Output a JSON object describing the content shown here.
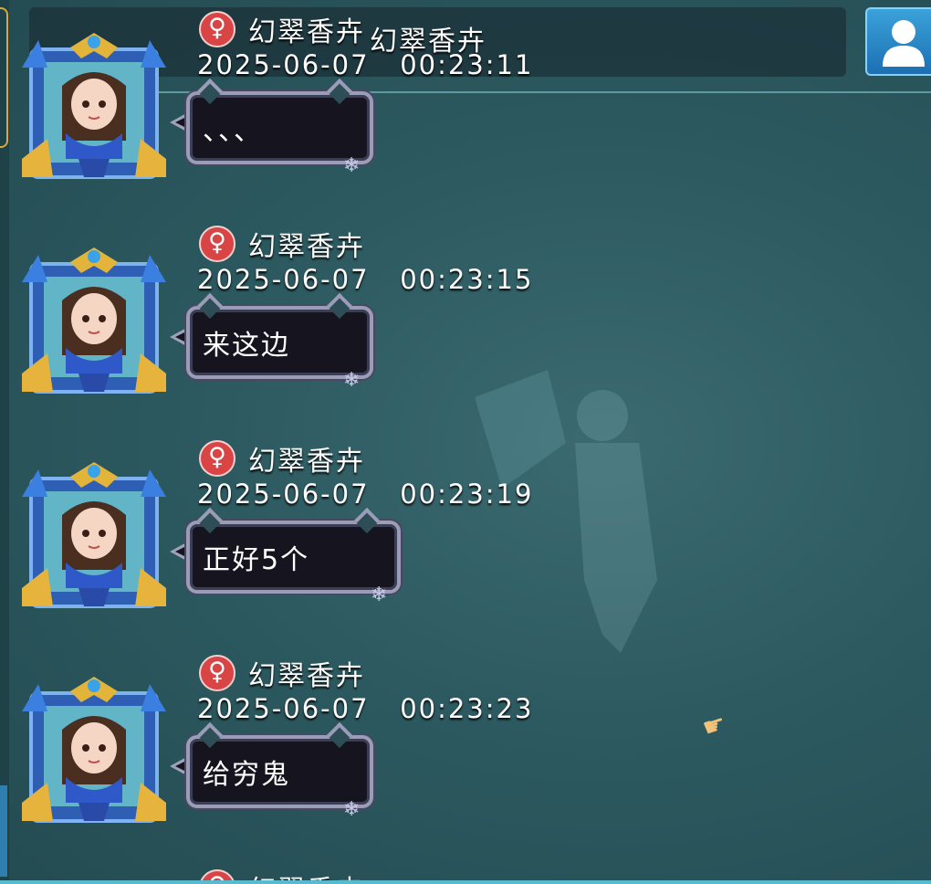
{
  "header": {
    "title": "幻翠香卉"
  },
  "messages": [
    {
      "gender_symbol": "♀",
      "sender": "幻翠香卉",
      "timestamp": "2025-06-07   00:23:11",
      "text": "、、、"
    },
    {
      "gender_symbol": "♀",
      "sender": "幻翠香卉",
      "timestamp": "2025-06-07   00:23:15",
      "text": "来这边"
    },
    {
      "gender_symbol": "♀",
      "sender": "幻翠香卉",
      "timestamp": "2025-06-07   00:23:19",
      "text": "正好5个"
    },
    {
      "gender_symbol": "♀",
      "sender": "幻翠香卉",
      "timestamp": "2025-06-07   00:23:23",
      "text": "给穷鬼"
    }
  ],
  "partial_message": {
    "gender_symbol": "♀",
    "sender": "幻翠香卉"
  },
  "icons": {
    "profile_button": "user-silhouette-icon",
    "gender": "female-symbol-icon",
    "cursor": "pointing-hand-icon"
  },
  "colors": {
    "gender_badge": "#d94545",
    "profile_button": "#2a8ed0"
  }
}
